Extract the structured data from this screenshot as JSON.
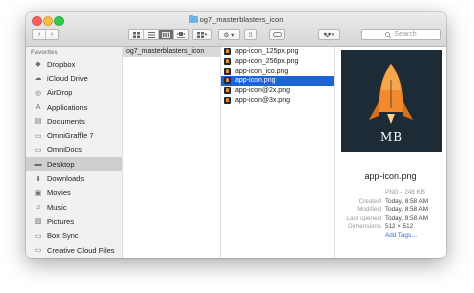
{
  "window": {
    "title": "og7_masterblasters_icon"
  },
  "toolbar": {
    "back_glyph": "‹",
    "forward_glyph": "›",
    "view_modes": [
      "icon-view",
      "list-view",
      "column-view",
      "cover-flow-view"
    ],
    "active_view": "column-view",
    "arrange_glyph": "▾",
    "action_glyph": "⚙ ▾",
    "share_glyph": "⇧",
    "tag_glyph": "",
    "dropbox_glyph": "▾",
    "search_placeholder": "Search"
  },
  "sidebar": {
    "heading": "Favorites",
    "items": [
      {
        "label": "Dropbox",
        "icon": "dropbox-icon"
      },
      {
        "label": "iCloud Drive",
        "icon": "cloud-icon"
      },
      {
        "label": "AirDrop",
        "icon": "airdrop-icon"
      },
      {
        "label": "Applications",
        "icon": "applications-icon"
      },
      {
        "label": "Documents",
        "icon": "document-icon"
      },
      {
        "label": "OmniGraffle 7",
        "icon": "folder-icon"
      },
      {
        "label": "OmniDocs",
        "icon": "folder-icon"
      },
      {
        "label": "Desktop",
        "icon": "desktop-icon",
        "selected": true
      },
      {
        "label": "Downloads",
        "icon": "downloads-icon"
      },
      {
        "label": "Movies",
        "icon": "movies-icon"
      },
      {
        "label": "Music",
        "icon": "music-icon"
      },
      {
        "label": "Pictures",
        "icon": "pictures-icon"
      },
      {
        "label": "Box Sync",
        "icon": "folder-icon"
      },
      {
        "label": "Creative Cloud Files",
        "icon": "folder-icon"
      }
    ]
  },
  "column1": {
    "items": [
      {
        "label": "og7_masterblasters_icon",
        "selected": true
      }
    ]
  },
  "column2": {
    "items": [
      {
        "label": "app-icon_125px.png"
      },
      {
        "label": "app-icon_256px.png"
      },
      {
        "label": "app-icon_ico.png"
      },
      {
        "label": "app-icon.png",
        "active": true
      },
      {
        "label": "app-icon@2x.png"
      },
      {
        "label": "app-icon@3x.png"
      }
    ]
  },
  "preview": {
    "thumb_text": "MB",
    "name": "app-icon.png",
    "kind_size": "PNG - 248 KB",
    "meta": [
      {
        "key": "Created",
        "value": "Today, 8:58 AM"
      },
      {
        "key": "Modified",
        "value": "Today, 8:58 AM"
      },
      {
        "key": "Last opened",
        "value": "Today, 8:58 AM"
      },
      {
        "key": "Dimensions",
        "value": "512 × 512"
      }
    ],
    "add_tags": "Add Tags…"
  },
  "colors": {
    "accent": "#1c63d5",
    "thumb_bg": "#1d2b36",
    "rocket": "#f08a2c"
  }
}
